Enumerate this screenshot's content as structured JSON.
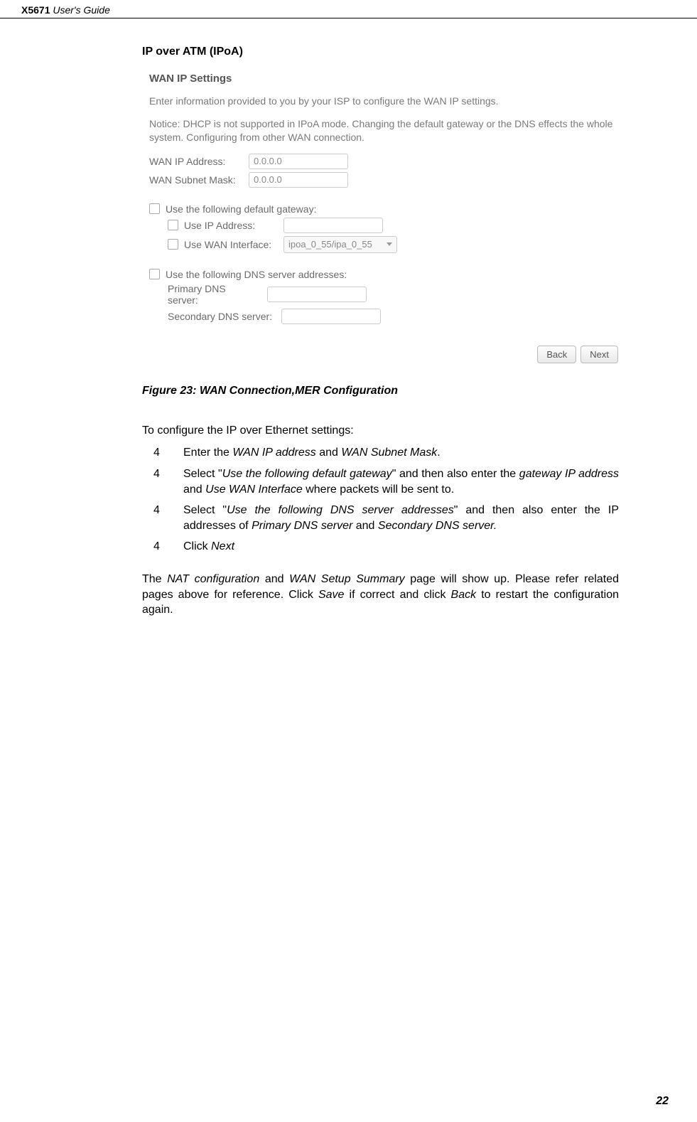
{
  "header": {
    "product": "X5671",
    "suffix": " User's Guide"
  },
  "section_title": "IP over ATM (IPoA)",
  "shot": {
    "title": "WAN IP Settings",
    "intro": "Enter information provided to you by your ISP to configure the WAN IP settings.",
    "notice": "Notice: DHCP is not supported in IPoA mode. Changing the default gateway or the DNS effects the whole system. Configuring from other WAN connection.",
    "wan_ip_label": "WAN IP Address:",
    "wan_ip_value": "0.0.0.0",
    "wan_mask_label": "WAN Subnet Mask:",
    "wan_mask_value": "0.0.0.0",
    "use_gateway": "Use the following default gateway:",
    "use_ip_addr": "Use IP Address:",
    "use_wan_if": "Use WAN Interface:",
    "wan_if_value": "ipoa_0_55/ipa_0_55",
    "use_dns": "Use the following DNS server addresses:",
    "primary_dns": "Primary DNS server:",
    "secondary_dns": "Secondary DNS server:",
    "back": "Back",
    "next": "Next"
  },
  "fig_caption": "Figure 23: WAN Connection,MER Configuration",
  "intro_line": "To configure the IP over Ethernet settings:",
  "steps": [
    {
      "n": "4",
      "pre": "Enter the ",
      "i1": "WAN IP address",
      "mid": " and ",
      "i2": "WAN Subnet Mask",
      "post": "."
    },
    {
      "n": "4",
      "pre": "Select \"",
      "i1": "Use the following default gateway",
      "mid": "\" and then also enter the ",
      "i2": "gateway IP address",
      "mid2": " and ",
      "i3": "Use WAN Interface",
      "post": " where packets will be sent to."
    },
    {
      "n": "4",
      "pre": "Select \"",
      "i1": "Use the following DNS server addresses",
      "mid": "\" and then also enter the IP addresses of ",
      "i2": "Primary DNS server",
      "mid2": " and ",
      "i3": "Secondary DNS server.",
      "post": ""
    },
    {
      "n": "4",
      "pre": "Click ",
      "i1": "Next",
      "mid": "",
      "i2": "",
      "post": ""
    }
  ],
  "closing": {
    "pre": "The ",
    "i1": "NAT configuration",
    "mid1": " and ",
    "i2": "WAN Setup Summary",
    "mid2": " page will show up. Please refer related pages above for reference. Click ",
    "i3": "Save",
    "mid3": " if correct and click ",
    "i4": "Back",
    "post": " to restart the configuration again."
  },
  "page_num": "22"
}
